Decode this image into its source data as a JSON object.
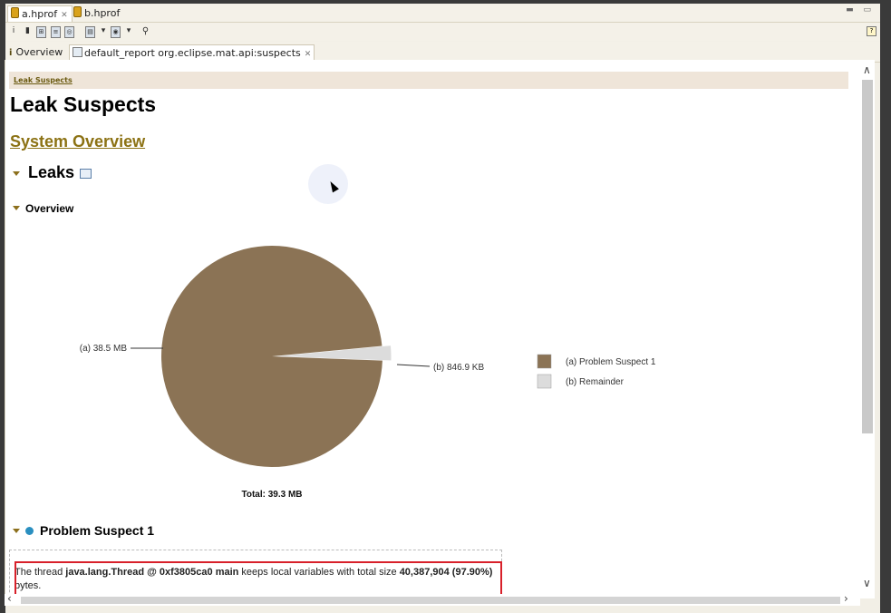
{
  "editor_tabs": [
    {
      "label": "a.hprof",
      "active": true
    },
    {
      "label": "b.hprof",
      "active": false
    }
  ],
  "inner_tabs": {
    "overview_label": "Overview",
    "report_label": "default_report  org.eclipse.mat.api:suspects"
  },
  "breadcrumb": "Leak Suspects",
  "page_title": "Leak Suspects",
  "system_overview_link": "System Overview",
  "leaks_heading": "Leaks",
  "overview_heading": "Overview",
  "chart_data": {
    "type": "pie",
    "slices": [
      {
        "label": "(a)  38.5 MB",
        "legend": "(a)  Problem Suspect 1",
        "value": 38.5,
        "unit": "MB",
        "color": "#8b7355"
      },
      {
        "label": "(b)  846.9 KB",
        "legend": "(b)  Remainder",
        "value": 0.827,
        "unit": "MB",
        "color": "#dcdcdc"
      }
    ],
    "total_label": "Total: 39.3 MB",
    "legend_position": "right"
  },
  "problem_suspect_heading": "Problem Suspect 1",
  "description": {
    "pre": "The thread ",
    "thread": "java.lang.Thread @ 0xf3805ca0 main",
    "mid": " keeps local variables with total size ",
    "size": "40,387,904 (97.90%)",
    "post": " bytes."
  },
  "colors": {
    "accent_link": "#8c7214",
    "highlight": "#d8202a",
    "breadcrumb_bg": "#efe5d9"
  },
  "icons": [
    "file-icon",
    "info-icon",
    "report-icon",
    "search-icon",
    "help-icon",
    "suspect-icon"
  ]
}
